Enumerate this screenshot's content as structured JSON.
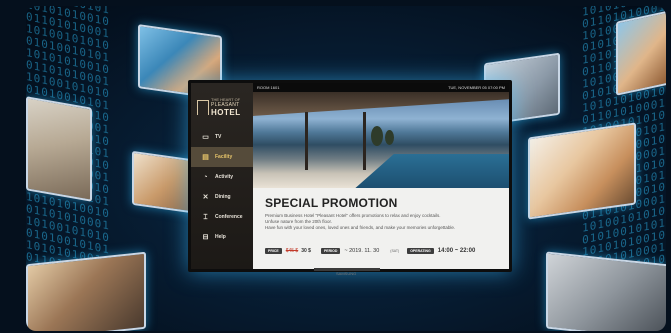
{
  "binary": {
    "left": "01010010101\n10101010010\n01101010001\n10100101010\n01010010101\n10101010010\n01101010001\n10100101010\n01010010101\n10101010010\n01101010001\n10100101010\n01010010101\n10101010010\n01101010001\n10100101010\n01010010101\n10101010010\n01101010001\n10100101010\n01010010101\n10101010010\n01101010001\n10100101010\n01010010101\n10101010010",
    "right": "10101010010\n01101010001\n10100101010\n01010010101\n10101010010\n01101010001\n10100101010\n01010010101\n10101010010\n01101010001\n10100101010\n01010010101\n10101010010\n01101010001\n10100101010\n01010010101\n10101010010\n01101010001\n10100101010\n01010010101\n10101010010\n01101010001\n10100101010\n01010010101\n10101010010\n01101010001"
  },
  "hotel": {
    "small_text": "THE HEART OF",
    "name_line1": "PLEASANT",
    "name_line2": "HOTEL"
  },
  "topbar": {
    "room": "ROOM 1601",
    "date": "TUE, NOVEMBER 05   07:00 PM"
  },
  "menu": [
    {
      "label": "TV",
      "icon": "tv-icon",
      "glyph": "▭",
      "active": false
    },
    {
      "label": "Facility",
      "icon": "facility-icon",
      "glyph": "▤",
      "active": true
    },
    {
      "label": "Activity",
      "icon": "activity-icon",
      "glyph": "◔",
      "active": false
    },
    {
      "label": "Dining",
      "icon": "dining-icon",
      "glyph": "✕",
      "active": false
    },
    {
      "label": "Conference",
      "icon": "conference-icon",
      "glyph": "⌶",
      "active": false
    },
    {
      "label": "Help",
      "icon": "help-icon",
      "glyph": "⊟",
      "active": false
    }
  ],
  "promo": {
    "title": "SPECIAL PROMOTION",
    "desc_lines": [
      "Premium Business Hotel \"Pleasant Hotel\" offers promotions to relax and enjoy cocktails.",
      "Unfuse nature from the 20th floor.",
      "Have fun with your loved ones, loved ones and friends, and make your memories unforgettable."
    ],
    "price_tag": "PRICE",
    "price_old": "$45 $",
    "price_new": "30 $",
    "period_tag": "PERIOD",
    "period_value": "~ 2019. 11. 30",
    "period_day": "(SAT)",
    "hours_tag": "OPERATING",
    "hours_value": "14:00 ~ 22:00"
  },
  "tv_brand": "SAMSUNG"
}
